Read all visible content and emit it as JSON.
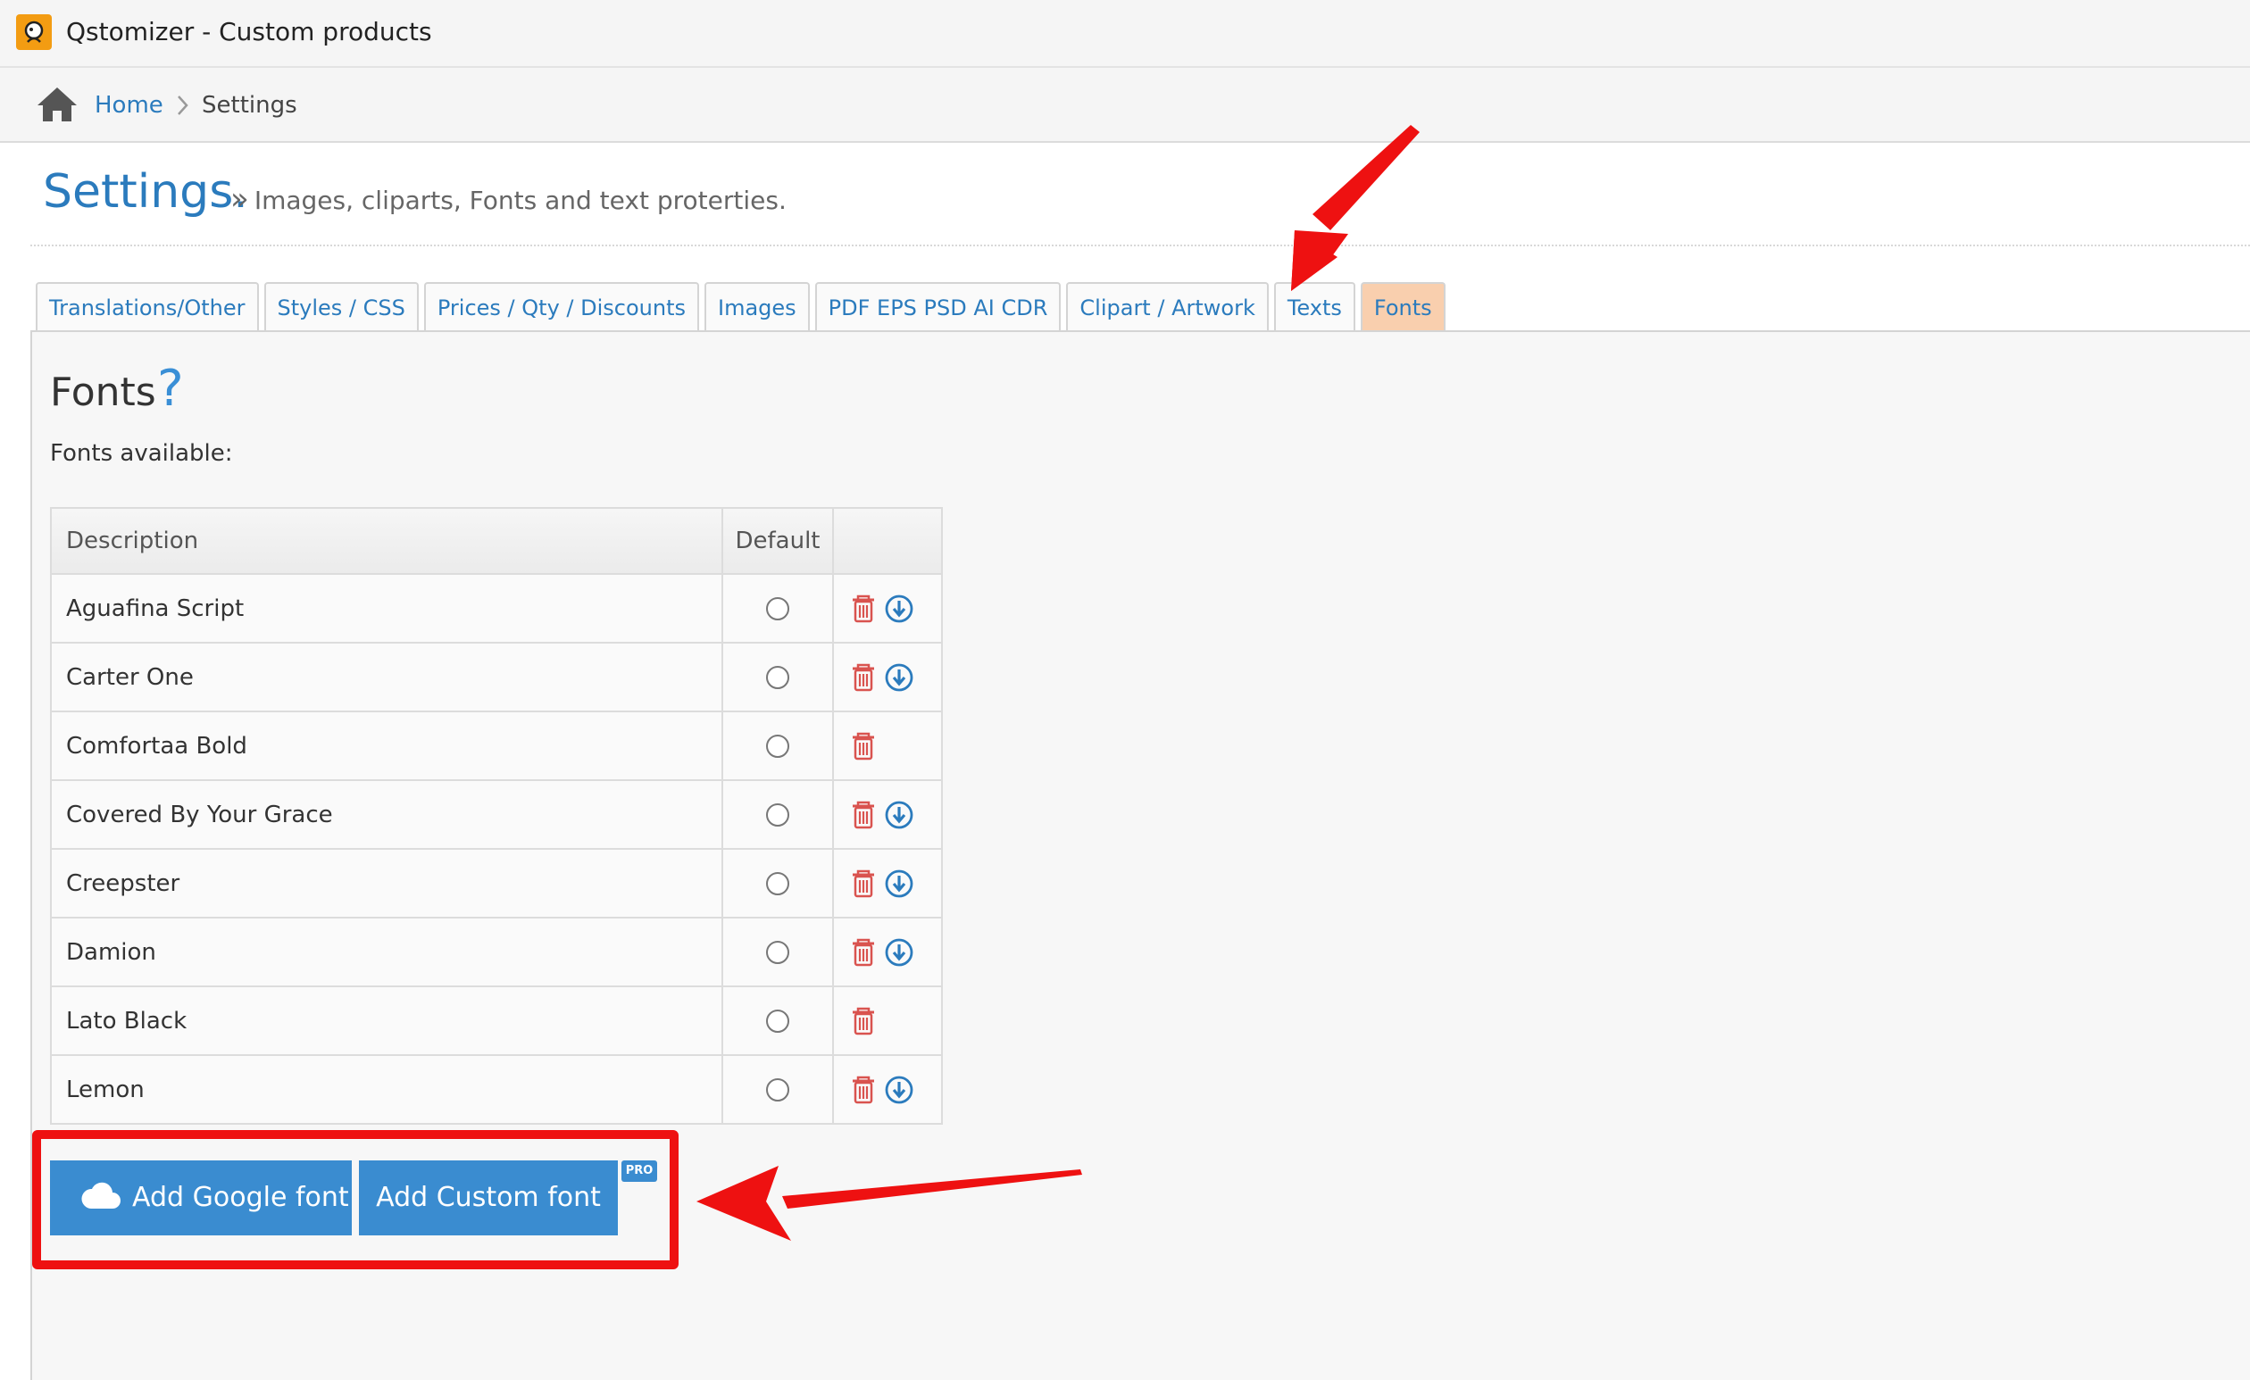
{
  "app": {
    "title": "Qstomizer - Custom products"
  },
  "breadcrumb": {
    "home": "Home",
    "current": "Settings"
  },
  "header": {
    "title": "Settings.",
    "subtitle": "Images, cliparts, Fonts and text proterties."
  },
  "tabs": [
    {
      "label": "Translations/Other"
    },
    {
      "label": "Styles / CSS"
    },
    {
      "label": "Prices / Qty / Discounts"
    },
    {
      "label": "Images"
    },
    {
      "label": "PDF EPS PSD AI CDR"
    },
    {
      "label": "Clipart / Artwork"
    },
    {
      "label": "Texts"
    },
    {
      "label": "Fonts",
      "active": true
    }
  ],
  "fonts_section": {
    "heading": "Fonts",
    "help_glyph": "?",
    "available_label": "Fonts available:",
    "columns": {
      "description": "Description",
      "default": "Default",
      "actions": ""
    },
    "rows": [
      {
        "name": "Aguafina Script",
        "download": true
      },
      {
        "name": "Carter One",
        "download": true
      },
      {
        "name": "Comfortaa Bold",
        "download": false
      },
      {
        "name": "Covered By Your Grace",
        "download": true
      },
      {
        "name": "Creepster",
        "download": true
      },
      {
        "name": "Damion",
        "download": true
      },
      {
        "name": "Lato Black",
        "download": false
      },
      {
        "name": "Lemon",
        "download": true
      }
    ]
  },
  "buttons": {
    "add_google": "Add Google font",
    "add_custom": "Add Custom font",
    "pro_badge": "PRO"
  },
  "icons": {
    "logo": "qstomizer-logo",
    "home": "home-icon",
    "delete": "trash-icon",
    "download": "download-circle-icon",
    "cloud": "cloud-icon"
  },
  "colors": {
    "link": "#2b7bbd",
    "active_tab": "#f9cfae",
    "button": "#3a8cd0",
    "delete": "#d9534f",
    "highlight": "#ee1111"
  }
}
